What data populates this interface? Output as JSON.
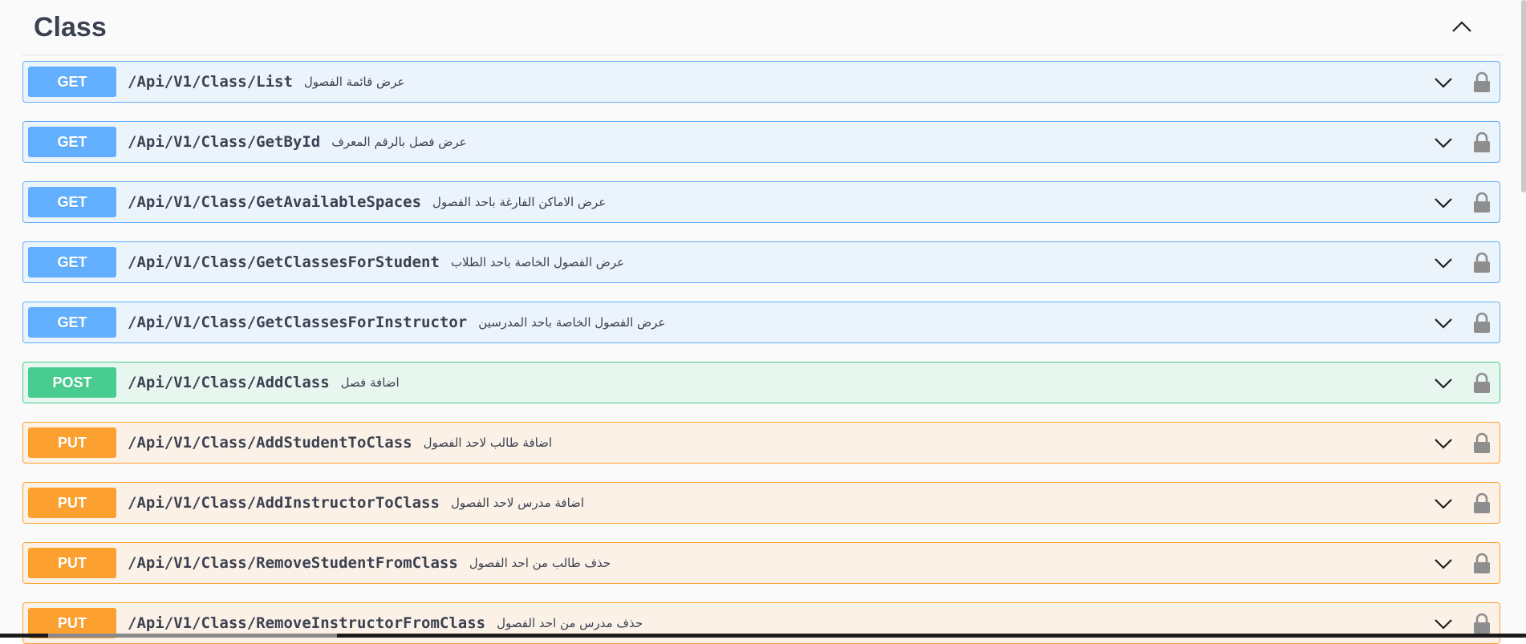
{
  "section": {
    "title": "Class",
    "collapse_icon": "chevron-up-icon"
  },
  "operations": [
    {
      "method": "GET",
      "path": "/Api/V1/Class/List",
      "description": "عرض قائمة الفصول"
    },
    {
      "method": "GET",
      "path": "/Api/V1/Class/GetById",
      "description": "عرض فصل بالرقم المعرف"
    },
    {
      "method": "GET",
      "path": "/Api/V1/Class/GetAvailableSpaces",
      "description": "عرض الاماكن الفارغة باحد الفصول"
    },
    {
      "method": "GET",
      "path": "/Api/V1/Class/GetClassesForStudent",
      "description": "عرض الفصول الخاصة باحد الطلاب"
    },
    {
      "method": "GET",
      "path": "/Api/V1/Class/GetClassesForInstructor",
      "description": "عرض الفصول الخاصة باحد المدرسين"
    },
    {
      "method": "POST",
      "path": "/Api/V1/Class/AddClass",
      "description": "اضافة فصل"
    },
    {
      "method": "PUT",
      "path": "/Api/V1/Class/AddStudentToClass",
      "description": "اضافة طالب لاحد الفصول"
    },
    {
      "method": "PUT",
      "path": "/Api/V1/Class/AddInstructorToClass",
      "description": "اضافة مدرس لاحد الفصول"
    },
    {
      "method": "PUT",
      "path": "/Api/V1/Class/RemoveStudentFromClass",
      "description": "حذف طالب من احد الفصول"
    },
    {
      "method": "PUT",
      "path": "/Api/V1/Class/RemoveInstructorFromClass",
      "description": "حذف مدرس من احد الفصول"
    }
  ],
  "colors": {
    "get": "#61affe",
    "post": "#49cc90",
    "put": "#fca130",
    "text": "#3b4151"
  },
  "icons": {
    "expand": "chevron-down-icon",
    "auth": "lock-icon"
  }
}
